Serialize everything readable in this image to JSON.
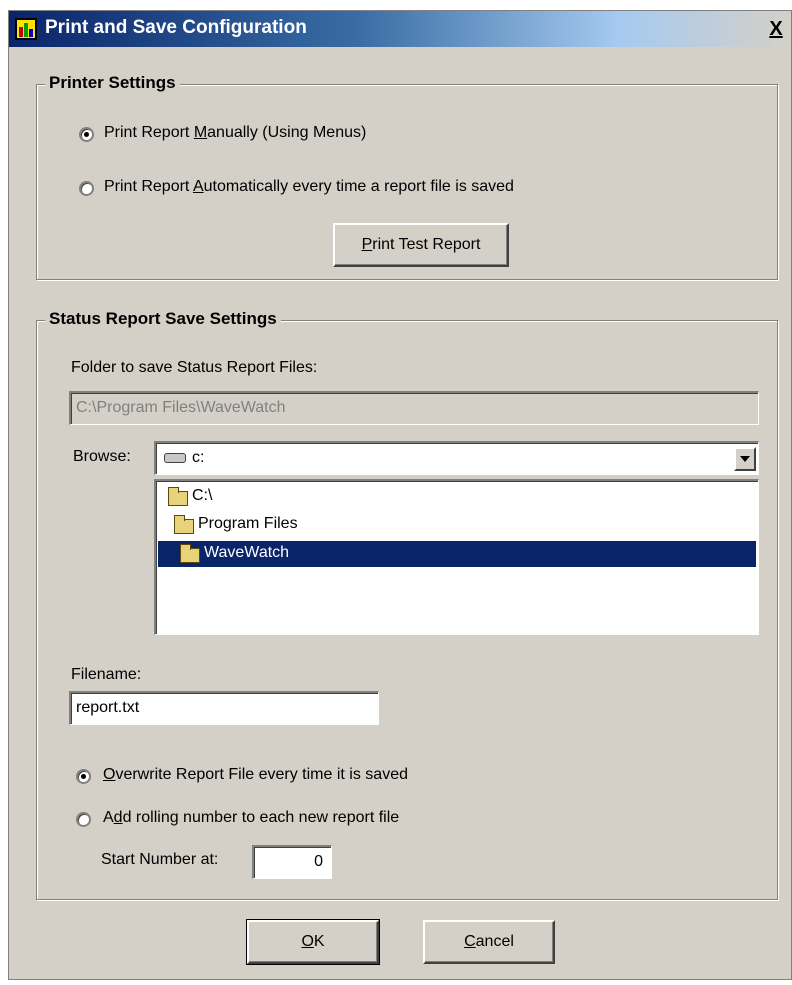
{
  "window": {
    "title": "Print and Save Configuration",
    "close_label": "X"
  },
  "printer_settings": {
    "legend": "Printer Settings",
    "radio_manual": {
      "pre": "Print Report ",
      "ul": "M",
      "post": "anually (Using Menus)",
      "checked": true
    },
    "radio_auto": {
      "pre": "Print Report ",
      "ul": "A",
      "post": "utomatically every time a report file is saved",
      "checked": false
    },
    "test_button": {
      "pre": "",
      "ul": "P",
      "post": "rint Test Report"
    }
  },
  "save_settings": {
    "legend": "Status Report Save Settings",
    "folder_label": "Folder to save Status Report Files:",
    "folder_value": "C:\\Program Files\\WaveWatch",
    "browse_label": "Browse:",
    "drive_value": "c:",
    "folders": [
      {
        "label": "C:\\",
        "selected": false
      },
      {
        "label": "Program Files",
        "selected": false
      },
      {
        "label": "WaveWatch",
        "selected": true
      }
    ],
    "filename_label": "Filename:",
    "filename_value": "report.txt",
    "radio_overwrite": {
      "pre": "",
      "ul": "O",
      "post": "verwrite Report File every time it is saved",
      "checked": true
    },
    "radio_rolling": {
      "pre": "A",
      "ul": "d",
      "post": "d rolling number to each new report file",
      "checked": false
    },
    "start_label": "Start Number at:",
    "start_value": "0"
  },
  "buttons": {
    "ok": {
      "pre": "",
      "ul": "O",
      "post": "K"
    },
    "cancel": {
      "pre": "",
      "ul": "C",
      "post": "ancel"
    }
  },
  "colors": {
    "face": "#d4d0c8",
    "title_start": "#0a246a",
    "selection": "#0a246a"
  }
}
